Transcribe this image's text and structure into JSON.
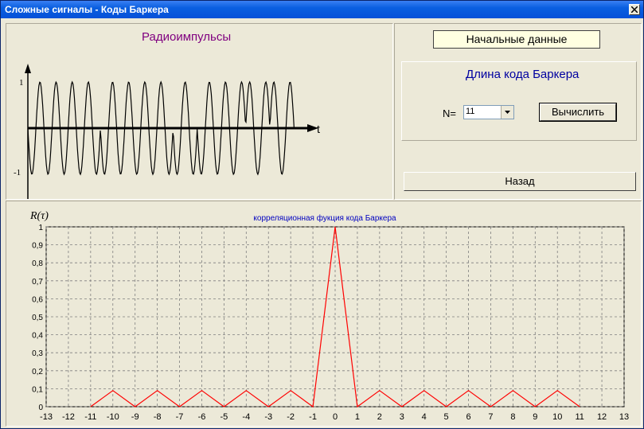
{
  "window": {
    "title": "Сложные сигналы - Коды Баркера"
  },
  "pulses": {
    "title": "Радиоимпульсы",
    "y_top": "1",
    "y_bottom": "-1",
    "x_axis": "t"
  },
  "controls": {
    "start_label": "Начальные данные",
    "group_title": "Длина кода Баркера",
    "n_label": "N=",
    "n_value": "11",
    "compute_button": "Вычислить",
    "back_button": "Назад"
  },
  "chart_data": {
    "type": "line",
    "title": "корреляционная фукция кода Баркера",
    "ylabel": "R(τ)",
    "xlim": [
      -13,
      13
    ],
    "ylim": [
      0,
      1
    ],
    "grid": true,
    "x_ticks": [
      "-13",
      "-12",
      "-11",
      "-10",
      "-9",
      "-8",
      "-7",
      "-6",
      "-5",
      "-4",
      "-3",
      "-2",
      "-1",
      "0",
      "1",
      "2",
      "3",
      "4",
      "5",
      "6",
      "7",
      "8",
      "9",
      "10",
      "11",
      "12",
      "13"
    ],
    "y_ticks": [
      "0",
      "0,1",
      "0,2",
      "0,3",
      "0,4",
      "0,5",
      "0,6",
      "0,7",
      "0,8",
      "0,9",
      "1"
    ],
    "series": [
      {
        "color": "#FF0000",
        "x": [
          -11,
          -10,
          -9,
          -8,
          -7,
          -6,
          -5,
          -4,
          -3,
          -2,
          -1,
          0,
          1,
          2,
          3,
          4,
          5,
          6,
          7,
          8,
          9,
          10,
          11
        ],
        "y": [
          0,
          0.09,
          0,
          0.09,
          0,
          0.09,
          0,
          0.09,
          0,
          0.09,
          0,
          1,
          0,
          0.09,
          0,
          0.09,
          0,
          0.09,
          0,
          0.09,
          0,
          0.09,
          0
        ]
      }
    ]
  }
}
